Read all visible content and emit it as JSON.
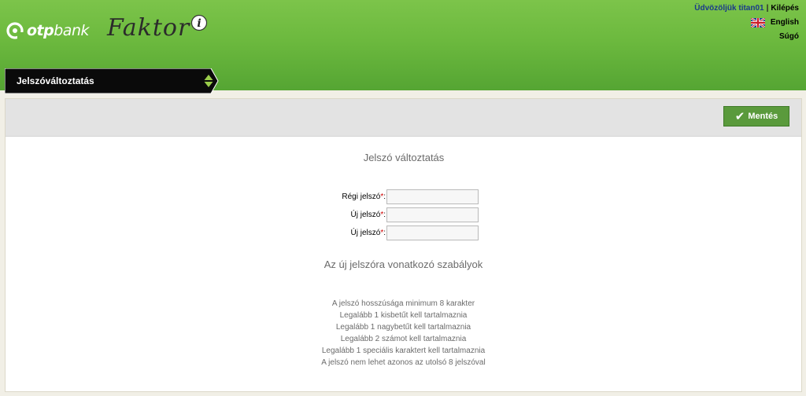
{
  "brand": {
    "bank_name_bold": "otp",
    "bank_name_light": "bank",
    "app_name": "Faktor",
    "app_badge": "i"
  },
  "topbar": {
    "greeting": "Üdvözöljük titan01",
    "separator": "|",
    "logout_label": "Kilépés",
    "language_label": "English",
    "language_flag_icon": "uk-flag-icon",
    "help_label": "Súgó"
  },
  "menu": {
    "active_item": "Jelszóváltoztatás",
    "arrows_icon": "up-down-arrows-icon"
  },
  "toolbar": {
    "save_label": "Mentés",
    "save_icon": "checkmark-icon"
  },
  "form": {
    "title": "Jelszó változtatás",
    "required_marker": "*",
    "label_suffix": ":",
    "fields": [
      {
        "label": "Régi jelszó",
        "value": "",
        "placeholder": ""
      },
      {
        "label": "Új jelszó",
        "value": "",
        "placeholder": ""
      },
      {
        "label": "Új jelszó",
        "value": "",
        "placeholder": ""
      }
    ]
  },
  "rules": {
    "title": "Az új jelszóra vonatkozó szabályok",
    "items": [
      "A jelszó hosszúsága minimum 8 karakter",
      "Legalább 1 kisbetűt kell tartalmaznia",
      "Legalább 1 nagybetűt kell tartalmaznia",
      "Legalább 2 számot kell tartalmaznia",
      "Legalább 1 speciális karaktert kell tartalmaznia",
      "A jelszó nem lehet azonos az utolsó 8 jelszóval"
    ]
  },
  "colors": {
    "header_green": "#6cb93e",
    "save_button_green": "#5a9a3c",
    "menu_tab_black": "#000000",
    "required_red": "#d00000"
  }
}
